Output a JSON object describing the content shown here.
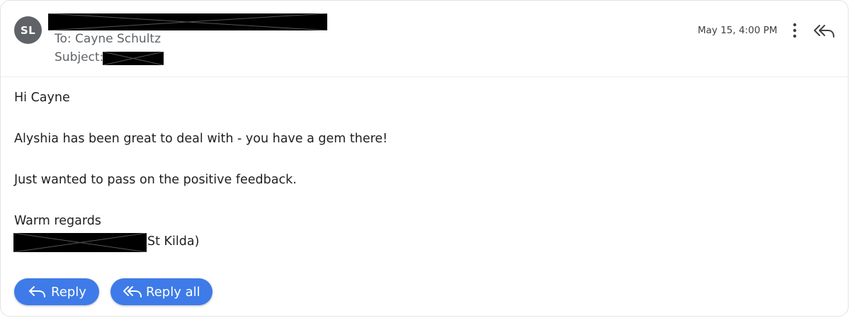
{
  "sender": {
    "avatar_initials": "SL",
    "to_line": "To: Cayne Schultz",
    "subject_label": "Subject:"
  },
  "meta": {
    "timestamp": "May 15, 4:00 PM"
  },
  "icons": {
    "more": "more-vertical-icon",
    "reply_all": "reply-all-icon",
    "reply": "reply-icon"
  },
  "body": {
    "greeting": "Hi Cayne",
    "paragraph_1": "Alyshia has been great to deal with - you have a gem there!",
    "paragraph_2": "Just wanted to pass on the positive feedback.",
    "closing": "Warm regards",
    "signature_tail": "St Kilda)"
  },
  "actions": {
    "reply_label": "Reply",
    "reply_all_label": "Reply all"
  },
  "colors": {
    "button_blue": "#3e7be8",
    "avatar_gray": "#5f6368"
  }
}
